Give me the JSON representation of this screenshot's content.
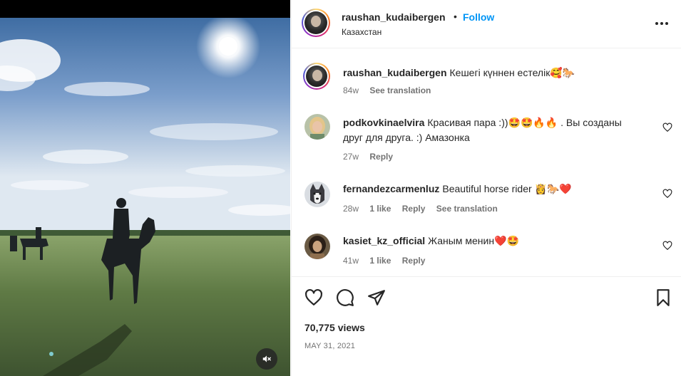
{
  "post": {
    "username": "raushan_kudaibergen",
    "separator": "•",
    "follow_label": "Follow",
    "location": "Казахстан"
  },
  "comments": [
    {
      "username": "raushan_kudaibergen",
      "text": "Кешегі күннен естелік🥰🐎",
      "time": "84w",
      "see_translation": "See translation",
      "avatar": "profile-photo"
    },
    {
      "username": "podkovkinaelvira",
      "text": "Красивая пара :))🤩🤩🔥🔥 . Вы созданы друг для друга. :) Амазонка",
      "time": "27w",
      "reply": "Reply",
      "avatar": "blonde-woman-photo"
    },
    {
      "username": "fernandezcarmenluz",
      "text": "Beautiful horse rider 👸🐎❤️",
      "time": "28w",
      "likes": "1 like",
      "reply": "Reply",
      "see_translation": "See translation",
      "avatar": "husky-dog-photo"
    },
    {
      "username": "kasiet_kz_official",
      "text": "Жаным менин❤️🤩",
      "time": "41w",
      "likes": "1 like",
      "reply": "Reply",
      "avatar": "woman-photo"
    }
  ],
  "stats": {
    "views": "70,775 views",
    "date": "MAY 31, 2021"
  },
  "icons": {
    "like": "heart-icon",
    "comment": "comment-icon",
    "share": "paper-plane-icon",
    "save": "bookmark-icon",
    "more": "ellipsis-icon",
    "mute": "speaker-muted-icon"
  },
  "colors": {
    "accent": "#0095f6",
    "text": "#262626",
    "secondary": "#737373",
    "border": "#efefef"
  }
}
